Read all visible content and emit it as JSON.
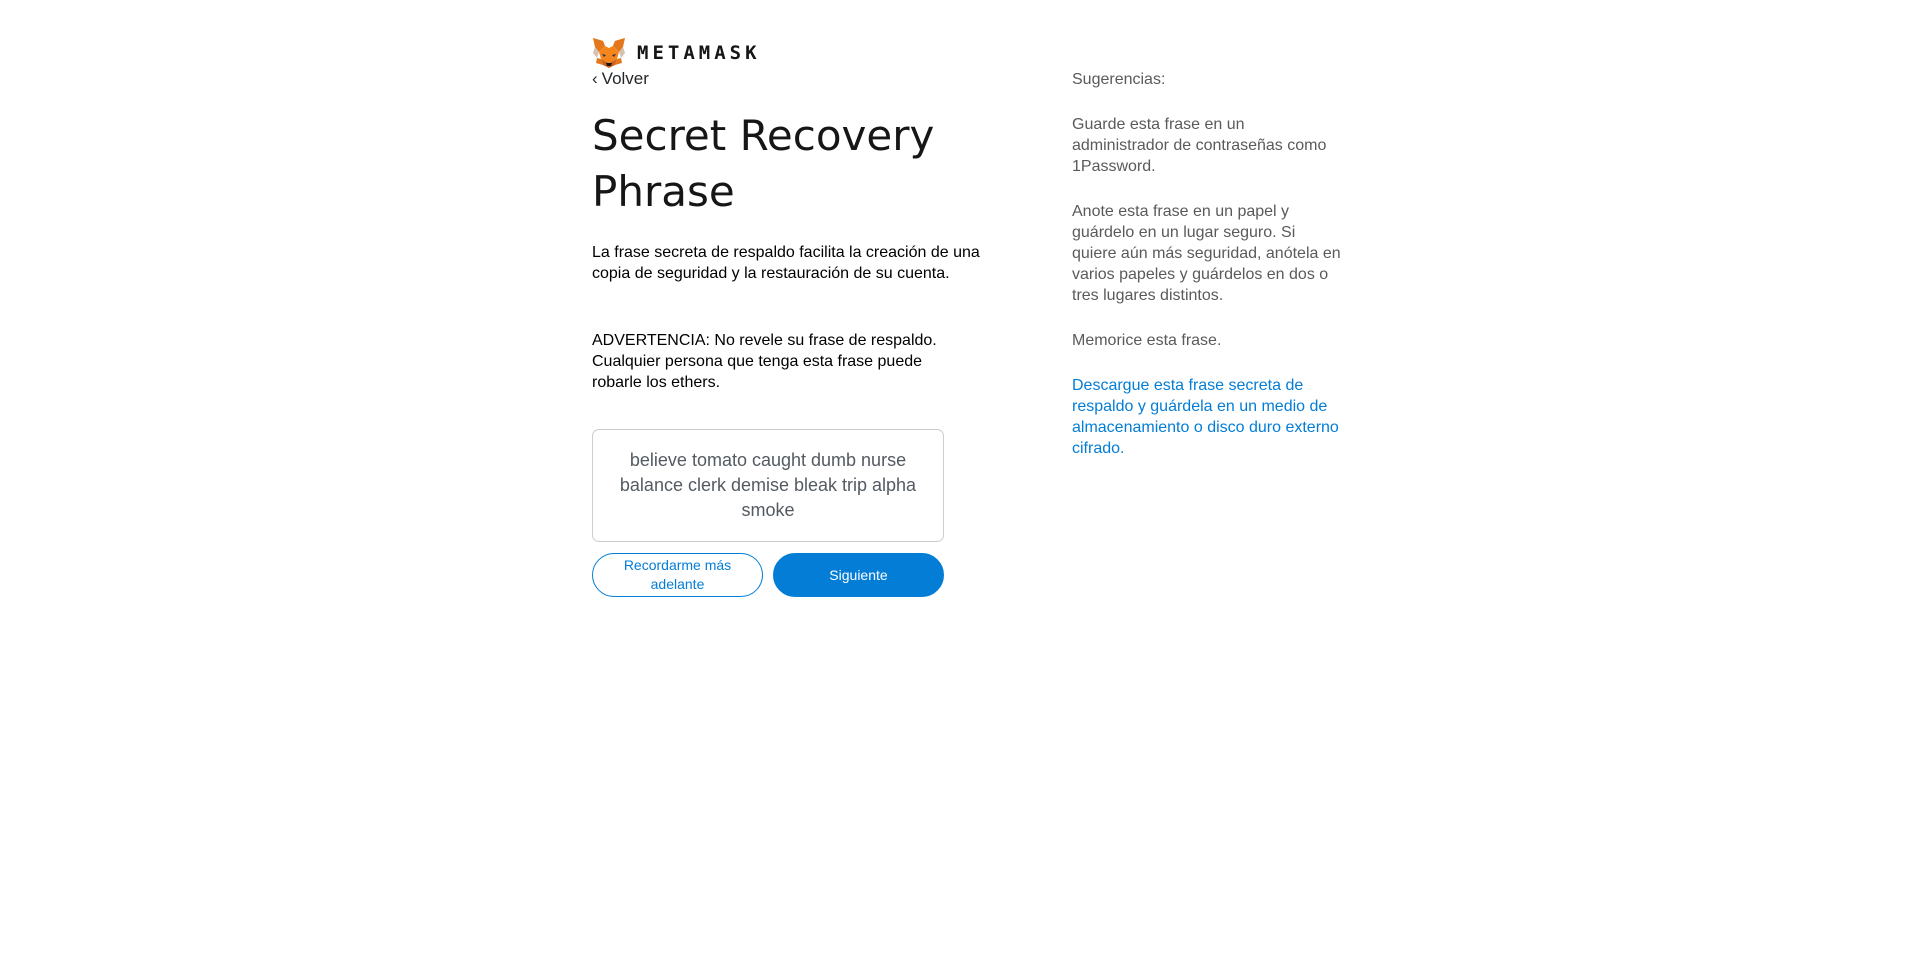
{
  "brand": {
    "name": "METAMASK",
    "logo_icon": "metamask-fox-icon"
  },
  "nav": {
    "back_label": "Volver",
    "back_icon": "chevron-left-icon"
  },
  "main": {
    "title": "Secret Recovery Phrase",
    "description": "La frase secreta de respaldo facilita la creación de una copia de seguridad y la restauración de su cuenta.",
    "warning": "ADVERTENCIA: No revele su frase de respaldo. Cualquier persona que tenga esta frase puede robarle los ethers.",
    "phrase": "believe tomato caught dumb nurse balance clerk demise bleak trip alpha smoke",
    "remind_later_label": "Recordarme más adelante",
    "next_label": "Siguiente"
  },
  "tips": {
    "heading": "Sugerencias:",
    "items": [
      "Guarde esta frase en un administrador de contraseñas como 1Password.",
      "Anote esta frase en un papel y guárdelo en un lugar seguro. Si quiere aún más seguridad, anótela en varios papeles y guárdelos en dos o tres lugares distintos.",
      "Memorice esta frase."
    ],
    "download_link": "Descargue esta frase secreta de respaldo y guárdela en un medio de almacenamiento o disco duro externo cifrado."
  },
  "colors": {
    "accent": "#037dd6",
    "text": "#24272a",
    "muted": "#5a5a5a",
    "fox_orange": "#e2761b"
  }
}
